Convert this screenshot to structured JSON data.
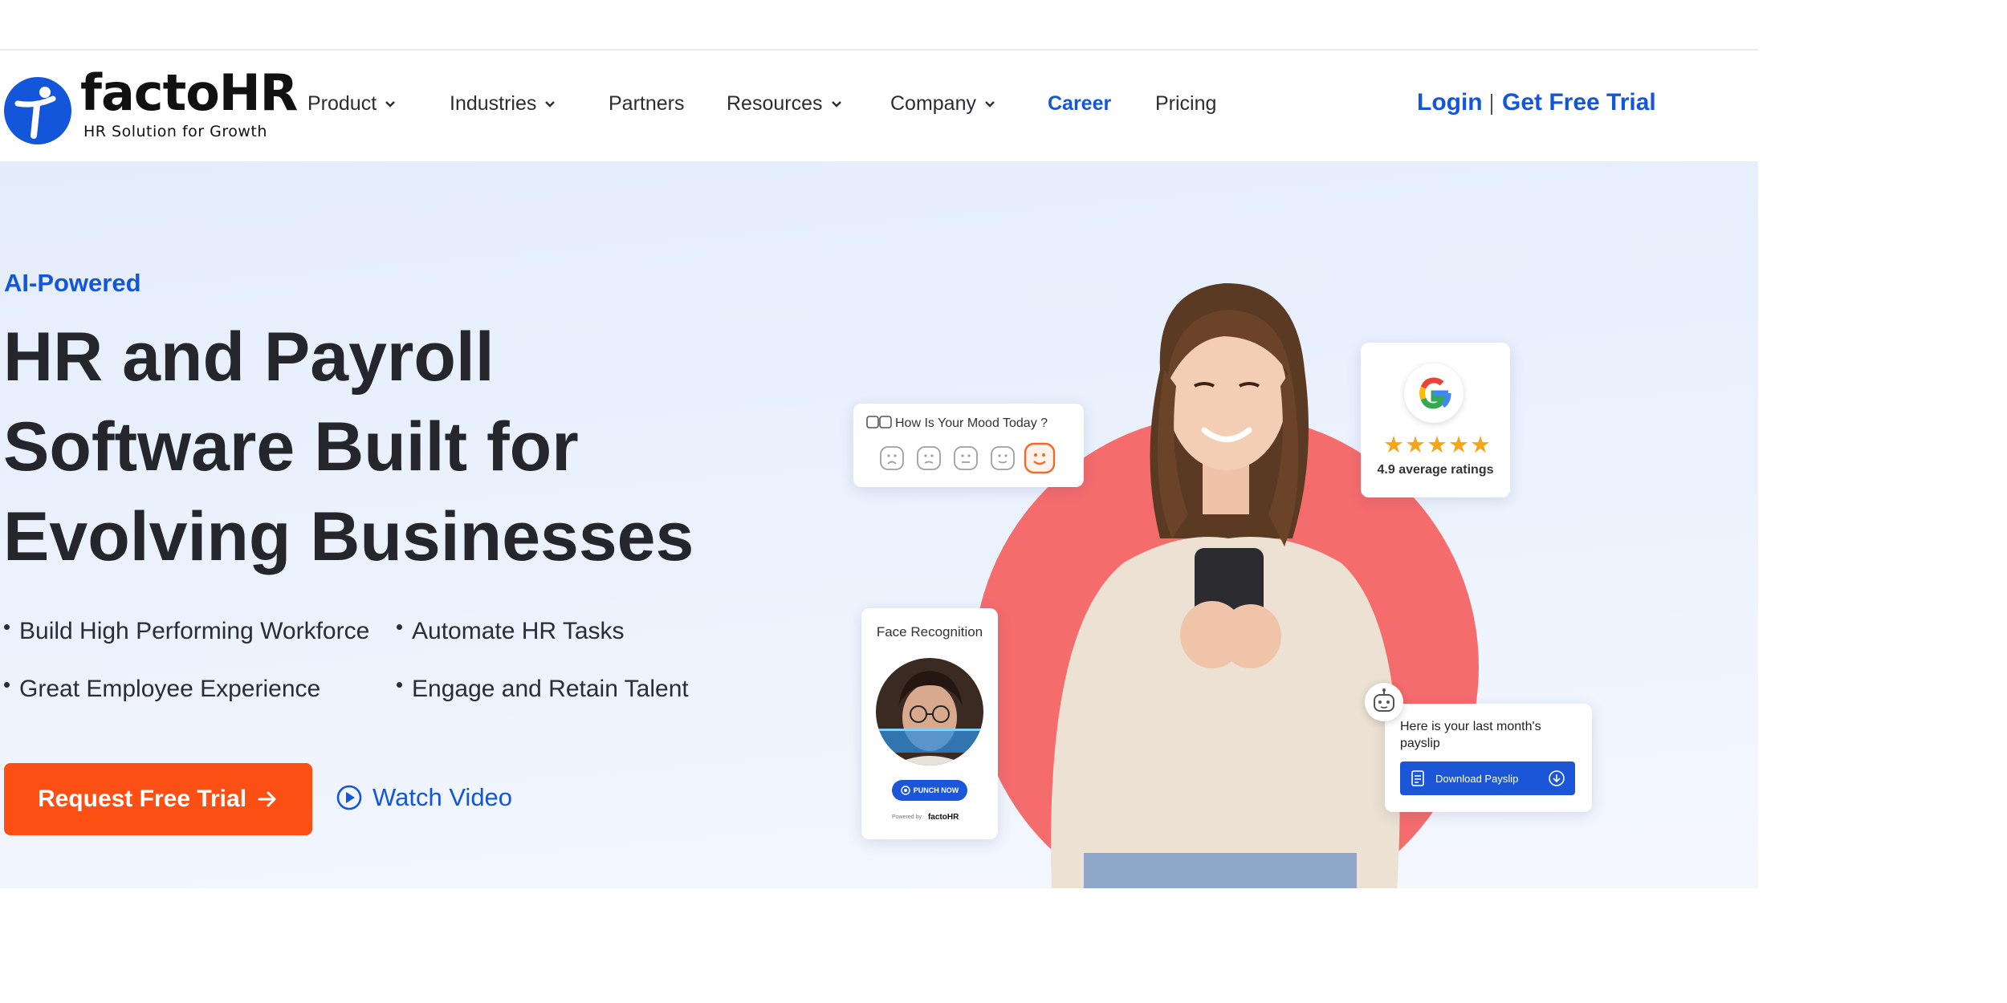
{
  "brand": {
    "name": "factoHR",
    "tagline": "HR Solution for Growth"
  },
  "nav": {
    "items": [
      {
        "label": "Product",
        "dropdown": true
      },
      {
        "label": "Industries",
        "dropdown": true
      },
      {
        "label": "Partners",
        "dropdown": false
      },
      {
        "label": "Resources",
        "dropdown": true
      },
      {
        "label": "Company",
        "dropdown": true
      },
      {
        "label": "Career",
        "dropdown": false
      },
      {
        "label": "Pricing",
        "dropdown": false
      }
    ],
    "login": "Login",
    "free_trial": "Get Free Trial"
  },
  "hero": {
    "eyebrow": "AI-Powered",
    "headline_lines": [
      "HR and Payroll",
      "Software Built for",
      "Evolving Businesses"
    ],
    "bullets": [
      "Build High Performing Workforce",
      "Automate HR Tasks",
      "Great Employee Experience",
      "Engage and Retain Talent"
    ],
    "cta": "Request Free Trial",
    "watch": "Watch Video"
  },
  "cards": {
    "mood": {
      "title": "How Is Your Mood Today ?",
      "selected_index": 4
    },
    "rating": {
      "text": "4.9 average ratings",
      "stars": "★★★★★",
      "value": 4.9
    },
    "face": {
      "title": "Face Recognition",
      "punch": "PUNCH NOW",
      "powered": "Powered by",
      "powered_logo": "factoHR"
    },
    "payslip": {
      "text": "Here is your last month's payslip",
      "button": "Download Payslip"
    }
  },
  "colors": {
    "accent": "#1456d9",
    "cta": "#fb4f14",
    "circle": "#f56c6c"
  },
  "icons": [
    "chevron-down-icon",
    "arrow-right-icon",
    "play-circle-icon",
    "google-icon",
    "star-icon",
    "document-icon",
    "download-icon",
    "chatbot-icon"
  ]
}
